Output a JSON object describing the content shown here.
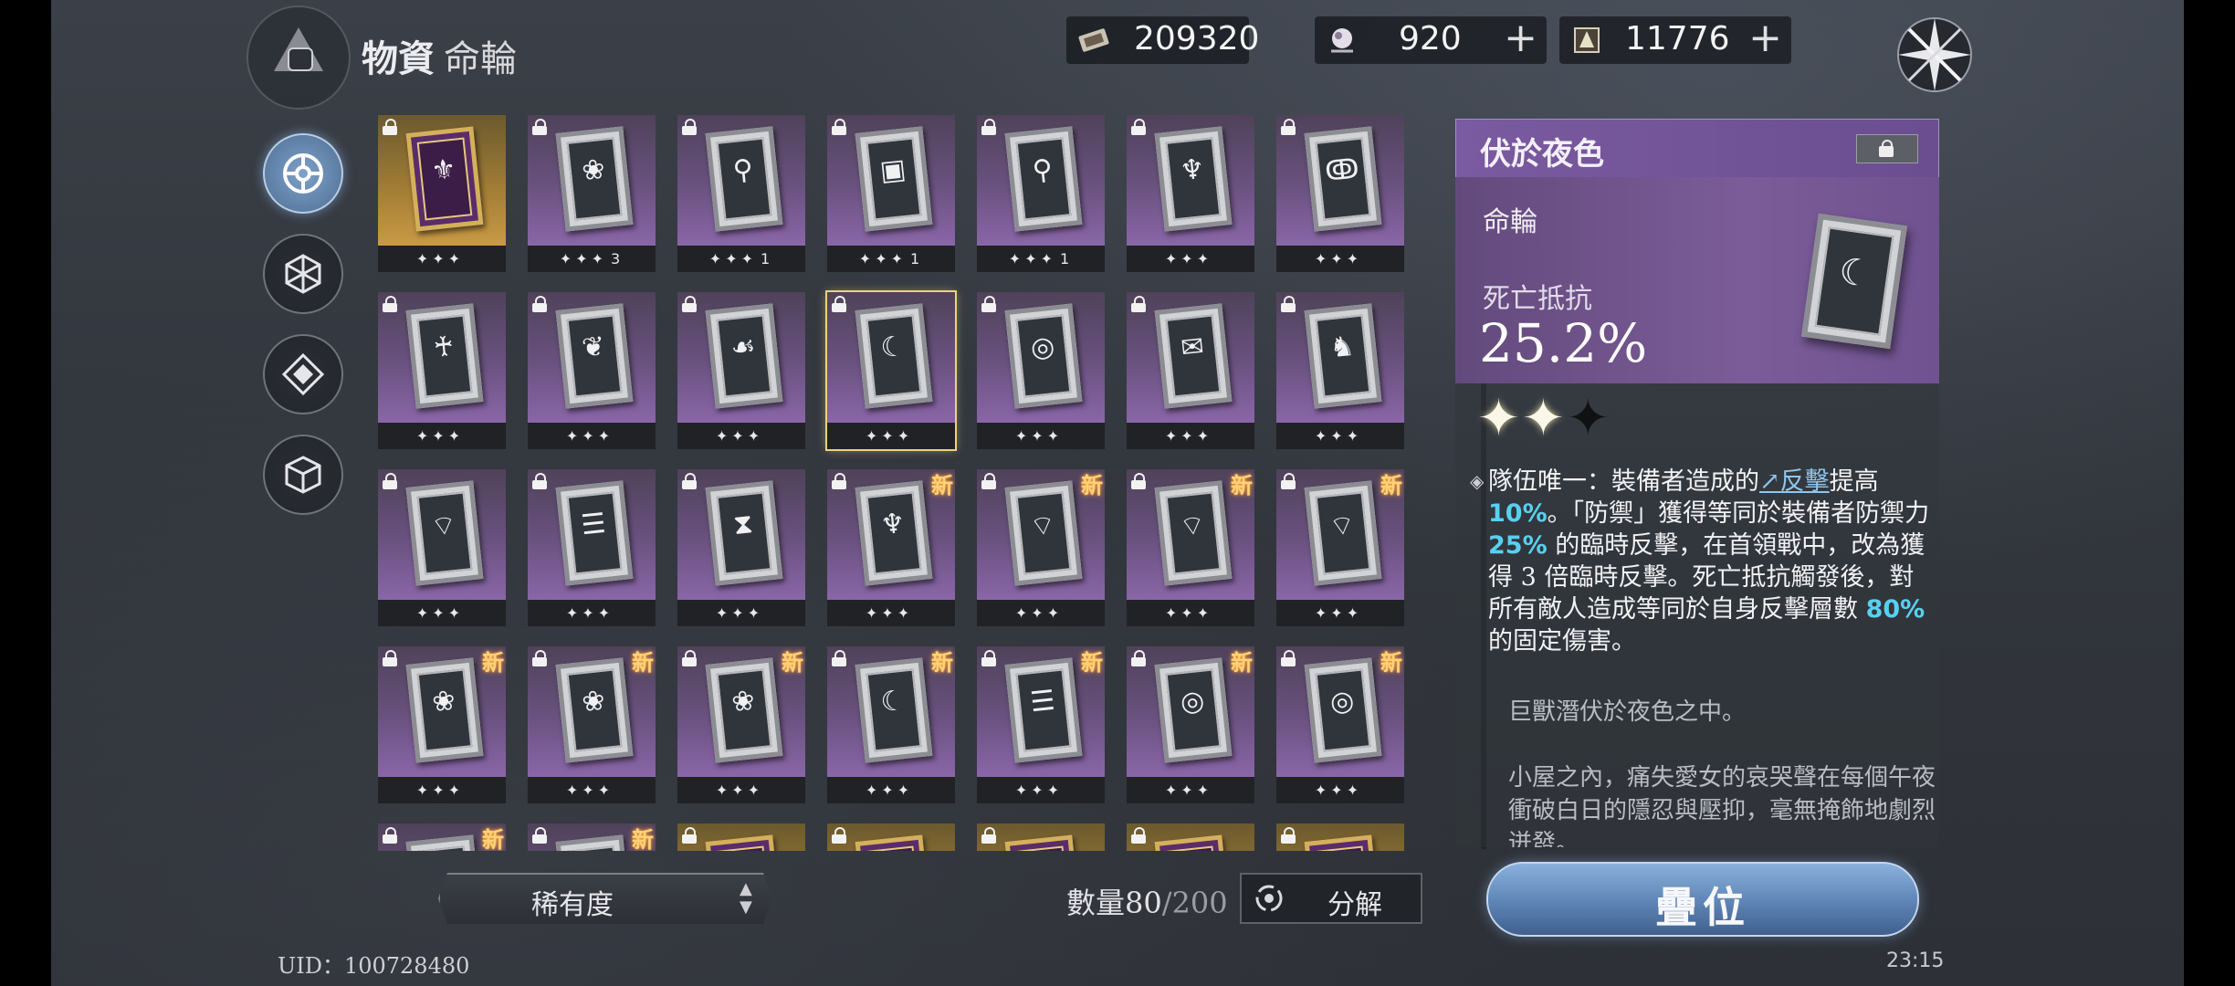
{
  "header": {
    "title": "物資",
    "subtitle": "命輪",
    "currencies": [
      {
        "name": "ticket",
        "icon": "ticket-icon",
        "value": "209320",
        "has_plus": false
      },
      {
        "name": "orb",
        "icon": "orb-icon",
        "value": "920",
        "has_plus": true
      },
      {
        "name": "crystal",
        "icon": "crystal-icon",
        "value": "11776",
        "has_plus": true
      }
    ]
  },
  "nav": [
    {
      "icon": "gear-wheel-icon",
      "active": true
    },
    {
      "icon": "hexagon-icon",
      "active": false
    },
    {
      "icon": "diamond-eye-icon",
      "active": false
    },
    {
      "icon": "cube-icon",
      "active": false
    }
  ],
  "grid": {
    "cards": [
      {
        "rarity": "gold",
        "stars": "✦✦✦",
        "count": "",
        "locked": true,
        "new": false,
        "glyph": "⚜"
      },
      {
        "rarity": "purple",
        "stars": "✦✦✦",
        "count": "3",
        "locked": true,
        "new": false,
        "glyph": "❀"
      },
      {
        "rarity": "purple",
        "stars": "✦✦✦",
        "count": "1",
        "locked": true,
        "new": false,
        "glyph": "⚲"
      },
      {
        "rarity": "purple",
        "stars": "✦✦✦",
        "count": "1",
        "locked": true,
        "new": false,
        "glyph": "▣"
      },
      {
        "rarity": "purple",
        "stars": "✦✦✦",
        "count": "1",
        "locked": true,
        "new": false,
        "glyph": "⚲"
      },
      {
        "rarity": "purple",
        "stars": "✦✦✦",
        "count": "",
        "locked": true,
        "new": false,
        "glyph": "♆"
      },
      {
        "rarity": "purple",
        "stars": "✦✦✦",
        "count": "",
        "locked": true,
        "new": false,
        "glyph": "ↂ"
      },
      {
        "rarity": "purple",
        "stars": "✦✦✦",
        "count": "",
        "locked": true,
        "new": false,
        "glyph": "♰"
      },
      {
        "rarity": "purple",
        "stars": "✦✦✦",
        "count": "",
        "locked": true,
        "new": false,
        "glyph": "❦"
      },
      {
        "rarity": "purple",
        "stars": "✦✦✦",
        "count": "",
        "locked": true,
        "new": false,
        "glyph": "☙"
      },
      {
        "rarity": "purple",
        "stars": "✦✦✦",
        "count": "",
        "locked": true,
        "new": false,
        "glyph": "☾",
        "selected": true
      },
      {
        "rarity": "purple",
        "stars": "✦✦✦",
        "count": "",
        "locked": true,
        "new": false,
        "glyph": "◎"
      },
      {
        "rarity": "purple",
        "stars": "✦✦✦",
        "count": "",
        "locked": true,
        "new": false,
        "glyph": "✉"
      },
      {
        "rarity": "purple",
        "stars": "✦✦✦",
        "count": "",
        "locked": true,
        "new": false,
        "glyph": "♞"
      },
      {
        "rarity": "purple",
        "stars": "✦✦✦",
        "count": "",
        "locked": true,
        "new": false,
        "glyph": "⌔"
      },
      {
        "rarity": "purple",
        "stars": "✦✦✦",
        "count": "",
        "locked": true,
        "new": false,
        "glyph": "☰"
      },
      {
        "rarity": "purple",
        "stars": "✦✦✦",
        "count": "",
        "locked": true,
        "new": false,
        "glyph": "⧗"
      },
      {
        "rarity": "purple",
        "stars": "✦✦✦",
        "count": "",
        "locked": true,
        "new": true,
        "glyph": "♆"
      },
      {
        "rarity": "purple",
        "stars": "✦✦✦",
        "count": "",
        "locked": true,
        "new": true,
        "glyph": "⌔"
      },
      {
        "rarity": "purple",
        "stars": "✦✦✦",
        "count": "",
        "locked": true,
        "new": true,
        "glyph": "⌔"
      },
      {
        "rarity": "purple",
        "stars": "✦✦✦",
        "count": "",
        "locked": true,
        "new": true,
        "glyph": "⌔"
      },
      {
        "rarity": "purple",
        "stars": "✦✦✦",
        "count": "",
        "locked": true,
        "new": true,
        "glyph": "❀"
      },
      {
        "rarity": "purple",
        "stars": "✦✦✦",
        "count": "",
        "locked": true,
        "new": true,
        "glyph": "❀"
      },
      {
        "rarity": "purple",
        "stars": "✦✦✦",
        "count": "",
        "locked": true,
        "new": true,
        "glyph": "❀"
      },
      {
        "rarity": "purple",
        "stars": "✦✦✦",
        "count": "",
        "locked": true,
        "new": true,
        "glyph": "☾"
      },
      {
        "rarity": "purple",
        "stars": "✦✦✦",
        "count": "",
        "locked": true,
        "new": true,
        "glyph": "☰"
      },
      {
        "rarity": "purple",
        "stars": "✦✦✦",
        "count": "",
        "locked": true,
        "new": true,
        "glyph": "◎"
      },
      {
        "rarity": "purple",
        "stars": "✦✦✦",
        "count": "",
        "locked": true,
        "new": true,
        "glyph": "◎"
      },
      {
        "rarity": "purple",
        "stars": "",
        "count": "",
        "locked": true,
        "new": true,
        "glyph": "⌔"
      },
      {
        "rarity": "purple",
        "stars": "",
        "count": "",
        "locked": true,
        "new": true,
        "glyph": "❀"
      },
      {
        "rarity": "gold",
        "stars": "",
        "count": "",
        "locked": true,
        "new": false,
        "glyph": ""
      },
      {
        "rarity": "gold",
        "stars": "",
        "count": "",
        "locked": true,
        "new": false,
        "glyph": ""
      },
      {
        "rarity": "gold",
        "stars": "",
        "count": "",
        "locked": true,
        "new": false,
        "glyph": ""
      },
      {
        "rarity": "gold",
        "stars": "",
        "count": "",
        "locked": true,
        "new": false,
        "glyph": ""
      },
      {
        "rarity": "gold",
        "stars": "",
        "count": "",
        "locked": true,
        "new": false,
        "glyph": ""
      }
    ],
    "new_label": "新"
  },
  "bottom": {
    "sort_label": "稀有度",
    "count_label": "數量",
    "count_current": "80",
    "count_max": "/200",
    "decompose_label": "分解",
    "stack_label": "疊位",
    "uid": "UID：100728480",
    "clock": "23:15"
  },
  "detail": {
    "name": "伏於夜色",
    "type": "命輪",
    "attr_label": "死亡抵抗",
    "attr_value": "25.2%",
    "stars": [
      "✦",
      "✦",
      "✦"
    ],
    "desc_parts": [
      {
        "t": "隊伍唯一：裝備者造成的"
      },
      {
        "t": "↗反擊",
        "c": "kw"
      },
      {
        "t": "提高 "
      },
      {
        "t": "10%",
        "c": "hi"
      },
      {
        "t": "。「防禦」獲得等同於裝備者防禦力 "
      },
      {
        "t": "25%",
        "c": "hi"
      },
      {
        "t": " 的臨時反擊，在首領戰中，改為獲得 3 倍臨時反擊。死亡抵抗觸發後，對所有敵人造成等同於自身反擊層數 "
      },
      {
        "t": "80%",
        "c": "hi"
      },
      {
        "t": " 的固定傷害。"
      }
    ],
    "flavor1": "巨獸潛伏於夜色之中。",
    "flavor2": "小屋之內，痛失愛女的哀哭聲在每個午夜衝破白日的隱忍與壓抑，毫無掩飾地劇烈迸發。"
  },
  "colors": {
    "purple_card": "#6a5280",
    "gold_card": "#a07c35",
    "selected_outline": "#ecd27a",
    "highlight": "#58d0f0",
    "accent_blue": "#5d84b5"
  }
}
